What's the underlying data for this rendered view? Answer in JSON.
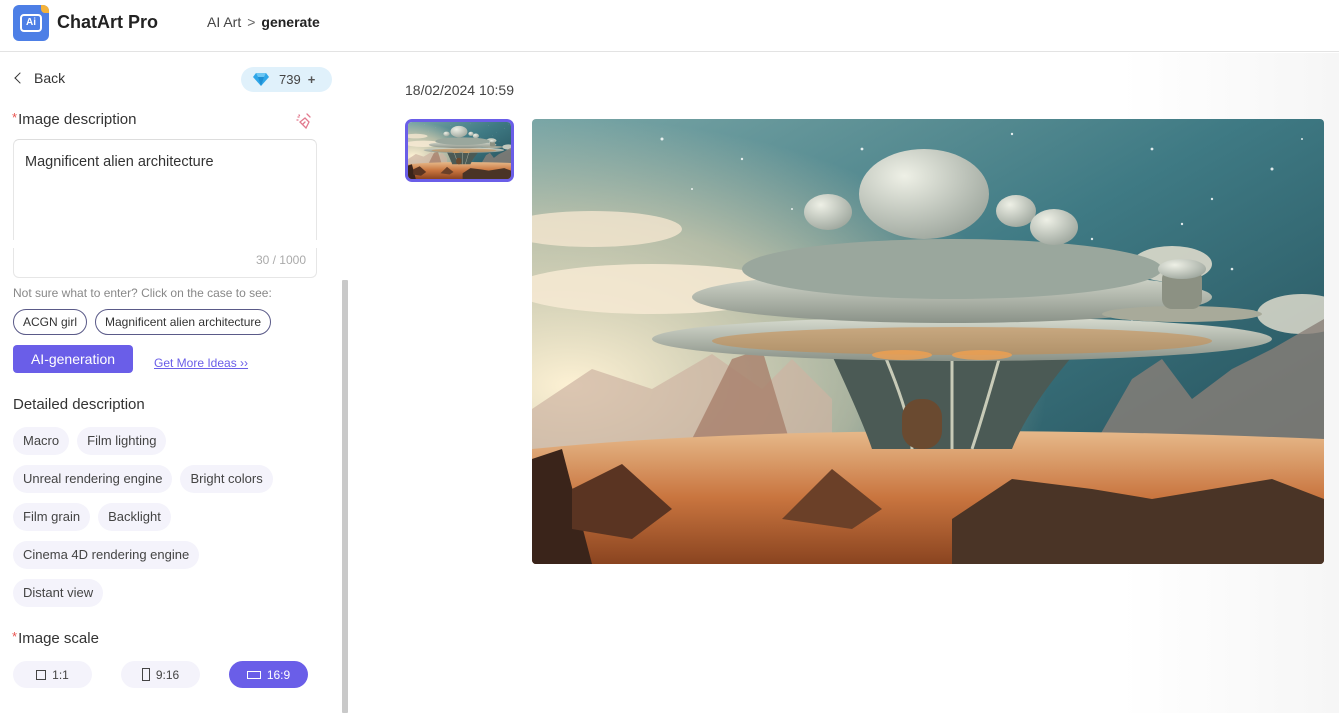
{
  "header": {
    "brand": "ChatArt Pro",
    "breadcrumb": {
      "parent": "AI Art",
      "separator": ">",
      "current": "generate"
    }
  },
  "sidebar": {
    "back_label": "Back",
    "credits": {
      "value": "739",
      "plus": "+",
      "icon": "diamond-icon"
    },
    "image_description": {
      "required_mark": "*",
      "label": "Image description",
      "clear_icon": "broom-icon",
      "value": "Magnificent alien architecture",
      "counter": "30 / 1000"
    },
    "hint": "Not sure what to enter? Click on the case to see:",
    "cases": [
      "ACGN girl",
      "Magnificent alien architecture"
    ],
    "ai_generation_label": "AI-generation",
    "more_ideas_label": "Get More Ideas ››",
    "detailed_description": {
      "label": "Detailed description",
      "tag_rows": [
        [
          "Macro",
          "Film lighting"
        ],
        [
          "Unreal rendering engine",
          "Bright colors"
        ],
        [
          "Film grain",
          "Backlight"
        ],
        [
          "Cinema 4D rendering engine"
        ],
        [
          "Distant view"
        ]
      ]
    },
    "image_scale": {
      "required_mark": "*",
      "label": "Image scale",
      "options": [
        {
          "label": "1:1",
          "icon": "square-icon",
          "active": false
        },
        {
          "label": "9:16",
          "icon": "portrait-icon",
          "active": false
        },
        {
          "label": "16:9",
          "icon": "landscape-icon",
          "active": true
        }
      ]
    }
  },
  "main": {
    "timestamp": "18/02/2024 10:59",
    "image_subject": "Magnificent alien architecture in a desert under a starry sky"
  },
  "colors": {
    "accent": "#6a5ee8",
    "logo_blue": "#4d7fe6",
    "credits_bg": "#e0f1fb",
    "required": "#e8534f",
    "tag_bg": "#f4f3fb"
  }
}
